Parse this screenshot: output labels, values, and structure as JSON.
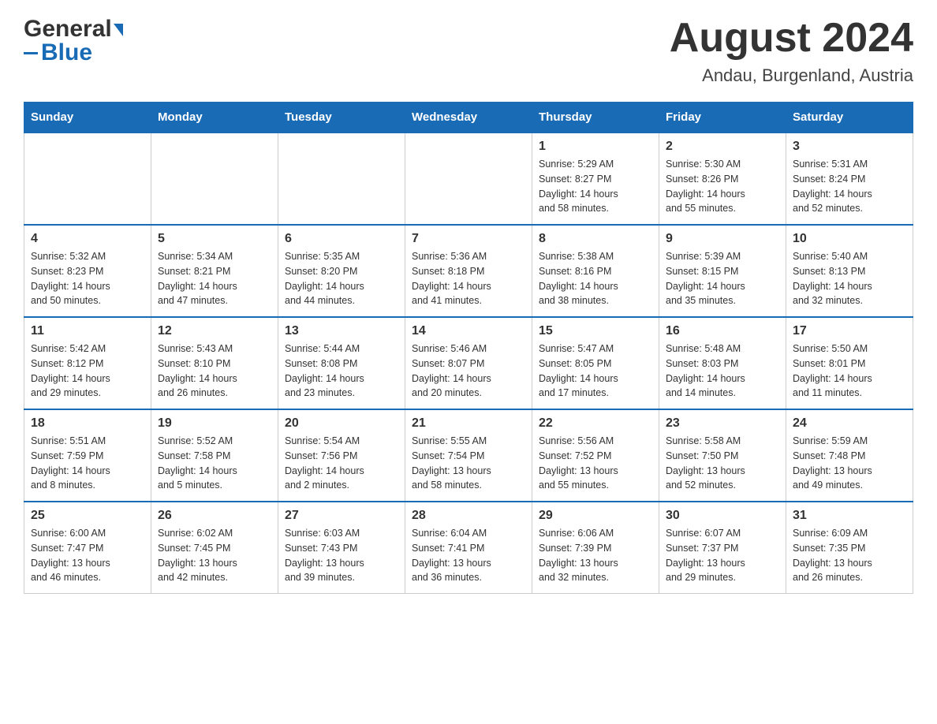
{
  "header": {
    "logo_main": "General",
    "logo_sub": "Blue",
    "month_title": "August 2024",
    "subtitle": "Andau, Burgenland, Austria"
  },
  "weekdays": [
    "Sunday",
    "Monday",
    "Tuesday",
    "Wednesday",
    "Thursday",
    "Friday",
    "Saturday"
  ],
  "weeks": [
    [
      {
        "day": "",
        "info": ""
      },
      {
        "day": "",
        "info": ""
      },
      {
        "day": "",
        "info": ""
      },
      {
        "day": "",
        "info": ""
      },
      {
        "day": "1",
        "info": "Sunrise: 5:29 AM\nSunset: 8:27 PM\nDaylight: 14 hours\nand 58 minutes."
      },
      {
        "day": "2",
        "info": "Sunrise: 5:30 AM\nSunset: 8:26 PM\nDaylight: 14 hours\nand 55 minutes."
      },
      {
        "day": "3",
        "info": "Sunrise: 5:31 AM\nSunset: 8:24 PM\nDaylight: 14 hours\nand 52 minutes."
      }
    ],
    [
      {
        "day": "4",
        "info": "Sunrise: 5:32 AM\nSunset: 8:23 PM\nDaylight: 14 hours\nand 50 minutes."
      },
      {
        "day": "5",
        "info": "Sunrise: 5:34 AM\nSunset: 8:21 PM\nDaylight: 14 hours\nand 47 minutes."
      },
      {
        "day": "6",
        "info": "Sunrise: 5:35 AM\nSunset: 8:20 PM\nDaylight: 14 hours\nand 44 minutes."
      },
      {
        "day": "7",
        "info": "Sunrise: 5:36 AM\nSunset: 8:18 PM\nDaylight: 14 hours\nand 41 minutes."
      },
      {
        "day": "8",
        "info": "Sunrise: 5:38 AM\nSunset: 8:16 PM\nDaylight: 14 hours\nand 38 minutes."
      },
      {
        "day": "9",
        "info": "Sunrise: 5:39 AM\nSunset: 8:15 PM\nDaylight: 14 hours\nand 35 minutes."
      },
      {
        "day": "10",
        "info": "Sunrise: 5:40 AM\nSunset: 8:13 PM\nDaylight: 14 hours\nand 32 minutes."
      }
    ],
    [
      {
        "day": "11",
        "info": "Sunrise: 5:42 AM\nSunset: 8:12 PM\nDaylight: 14 hours\nand 29 minutes."
      },
      {
        "day": "12",
        "info": "Sunrise: 5:43 AM\nSunset: 8:10 PM\nDaylight: 14 hours\nand 26 minutes."
      },
      {
        "day": "13",
        "info": "Sunrise: 5:44 AM\nSunset: 8:08 PM\nDaylight: 14 hours\nand 23 minutes."
      },
      {
        "day": "14",
        "info": "Sunrise: 5:46 AM\nSunset: 8:07 PM\nDaylight: 14 hours\nand 20 minutes."
      },
      {
        "day": "15",
        "info": "Sunrise: 5:47 AM\nSunset: 8:05 PM\nDaylight: 14 hours\nand 17 minutes."
      },
      {
        "day": "16",
        "info": "Sunrise: 5:48 AM\nSunset: 8:03 PM\nDaylight: 14 hours\nand 14 minutes."
      },
      {
        "day": "17",
        "info": "Sunrise: 5:50 AM\nSunset: 8:01 PM\nDaylight: 14 hours\nand 11 minutes."
      }
    ],
    [
      {
        "day": "18",
        "info": "Sunrise: 5:51 AM\nSunset: 7:59 PM\nDaylight: 14 hours\nand 8 minutes."
      },
      {
        "day": "19",
        "info": "Sunrise: 5:52 AM\nSunset: 7:58 PM\nDaylight: 14 hours\nand 5 minutes."
      },
      {
        "day": "20",
        "info": "Sunrise: 5:54 AM\nSunset: 7:56 PM\nDaylight: 14 hours\nand 2 minutes."
      },
      {
        "day": "21",
        "info": "Sunrise: 5:55 AM\nSunset: 7:54 PM\nDaylight: 13 hours\nand 58 minutes."
      },
      {
        "day": "22",
        "info": "Sunrise: 5:56 AM\nSunset: 7:52 PM\nDaylight: 13 hours\nand 55 minutes."
      },
      {
        "day": "23",
        "info": "Sunrise: 5:58 AM\nSunset: 7:50 PM\nDaylight: 13 hours\nand 52 minutes."
      },
      {
        "day": "24",
        "info": "Sunrise: 5:59 AM\nSunset: 7:48 PM\nDaylight: 13 hours\nand 49 minutes."
      }
    ],
    [
      {
        "day": "25",
        "info": "Sunrise: 6:00 AM\nSunset: 7:47 PM\nDaylight: 13 hours\nand 46 minutes."
      },
      {
        "day": "26",
        "info": "Sunrise: 6:02 AM\nSunset: 7:45 PM\nDaylight: 13 hours\nand 42 minutes."
      },
      {
        "day": "27",
        "info": "Sunrise: 6:03 AM\nSunset: 7:43 PM\nDaylight: 13 hours\nand 39 minutes."
      },
      {
        "day": "28",
        "info": "Sunrise: 6:04 AM\nSunset: 7:41 PM\nDaylight: 13 hours\nand 36 minutes."
      },
      {
        "day": "29",
        "info": "Sunrise: 6:06 AM\nSunset: 7:39 PM\nDaylight: 13 hours\nand 32 minutes."
      },
      {
        "day": "30",
        "info": "Sunrise: 6:07 AM\nSunset: 7:37 PM\nDaylight: 13 hours\nand 29 minutes."
      },
      {
        "day": "31",
        "info": "Sunrise: 6:09 AM\nSunset: 7:35 PM\nDaylight: 13 hours\nand 26 minutes."
      }
    ]
  ]
}
